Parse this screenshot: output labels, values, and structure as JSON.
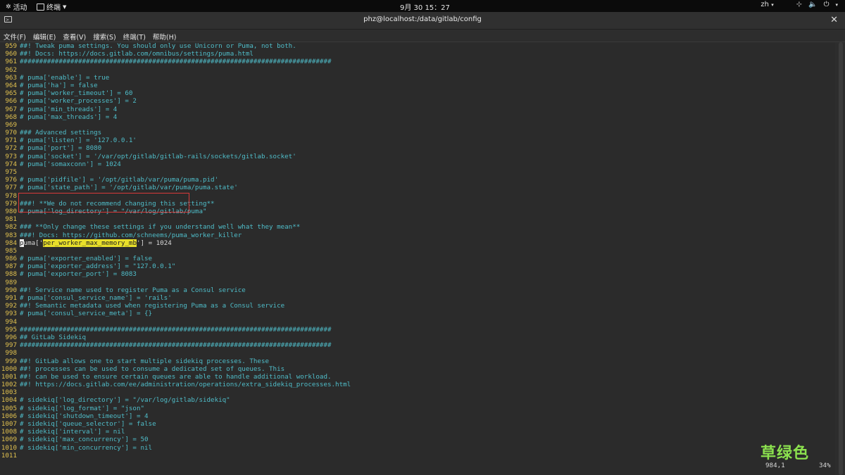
{
  "topbar": {
    "activities_label": "活动",
    "terminal_label": "终端",
    "clock": "9月 30 15：27",
    "lang": "zh"
  },
  "window": {
    "title": "phz@localhost:/data/gitlab/config"
  },
  "menu": [
    "文件(F)",
    "编辑(E)",
    "查看(V)",
    "搜索(S)",
    "终端(T)",
    "帮助(H)"
  ],
  "lines": [
    {
      "n": "959",
      "t": "##! Tweak puma settings. You should only use Unicorn or Puma, not both."
    },
    {
      "n": "960",
      "t": "##! Docs: https://docs.gitlab.com/omnibus/settings/puma.html"
    },
    {
      "n": "961",
      "t": "################################################################################"
    },
    {
      "n": "962",
      "t": ""
    },
    {
      "n": "963",
      "t": "# puma['enable'] = true"
    },
    {
      "n": "964",
      "t": "# puma['ha'] = false"
    },
    {
      "n": "965",
      "t": "# puma['worker_timeout'] = 60"
    },
    {
      "n": "966",
      "t": "# puma['worker_processes'] = 2"
    },
    {
      "n": "967",
      "t": "# puma['min_threads'] = 4"
    },
    {
      "n": "968",
      "t": "# puma['max_threads'] = 4"
    },
    {
      "n": "969",
      "t": ""
    },
    {
      "n": "970",
      "t": "### Advanced settings"
    },
    {
      "n": "971",
      "t": "# puma['listen'] = '127.0.0.1'"
    },
    {
      "n": "972",
      "t": "# puma['port'] = 8080"
    },
    {
      "n": "973",
      "t": "# puma['socket'] = '/var/opt/gitlab/gitlab-rails/sockets/gitlab.socket'"
    },
    {
      "n": "974",
      "t": "# puma['somaxconn'] = 1024"
    },
    {
      "n": "975",
      "t": ""
    },
    {
      "n": "976",
      "t": "# puma['pidfile'] = '/opt/gitlab/var/puma/puma.pid'"
    },
    {
      "n": "977",
      "t": "# puma['state_path'] = '/opt/gitlab/var/puma/puma.state'"
    },
    {
      "n": "978",
      "t": ""
    },
    {
      "n": "979",
      "t": "###! **We do not recommend changing this setting**"
    },
    {
      "n": "980",
      "t": "# puma['log_directory'] = \"/var/log/gitlab/puma\""
    },
    {
      "n": "981",
      "t": ""
    },
    {
      "n": "982",
      "t": "### **Only change these settings if you understand well what they mean**"
    },
    {
      "n": "983",
      "t": "###! Docs: https://github.com/schneems/puma_worker_killer"
    },
    {
      "n": "984",
      "special": true,
      "cursor_char": "p",
      "pre": "uma['",
      "hl": "per_worker_max_memory_mb",
      "post": "'] = 1024"
    },
    {
      "n": "985",
      "t": ""
    },
    {
      "n": "986",
      "t": "# puma['exporter_enabled'] = false"
    },
    {
      "n": "987",
      "t": "# puma['exporter_address'] = \"127.0.0.1\""
    },
    {
      "n": "988",
      "t": "# puma['exporter_port'] = 8083"
    },
    {
      "n": "989",
      "t": ""
    },
    {
      "n": "990",
      "t": "##! Service name used to register Puma as a Consul service"
    },
    {
      "n": "991",
      "t": "# puma['consul_service_name'] = 'rails'"
    },
    {
      "n": "992",
      "t": "##! Semantic metadata used when registering Puma as a Consul service"
    },
    {
      "n": "993",
      "t": "# puma['consul_service_meta'] = {}"
    },
    {
      "n": "994",
      "t": ""
    },
    {
      "n": "995",
      "t": "################################################################################"
    },
    {
      "n": "996",
      "t": "## GitLab Sidekiq"
    },
    {
      "n": "997",
      "t": "################################################################################"
    },
    {
      "n": "998",
      "t": ""
    },
    {
      "n": "999",
      "t": "##! GitLab allows one to start multiple sidekiq processes. These"
    },
    {
      "n": "1000",
      "t": "##! processes can be used to consume a dedicated set of queues. This"
    },
    {
      "n": "1001",
      "t": "##! can be used to ensure certain queues are able to handle additional workload."
    },
    {
      "n": "1002",
      "t": "##! https://docs.gitlab.com/ee/administration/operations/extra_sidekiq_processes.html"
    },
    {
      "n": "1003",
      "t": ""
    },
    {
      "n": "1004",
      "t": "# sidekiq['log_directory'] = \"/var/log/gitlab/sidekiq\""
    },
    {
      "n": "1005",
      "t": "# sidekiq['log_format'] = \"json\""
    },
    {
      "n": "1006",
      "t": "# sidekiq['shutdown_timeout'] = 4"
    },
    {
      "n": "1007",
      "t": "# sidekiq['queue_selector'] = false"
    },
    {
      "n": "1008",
      "t": "# sidekiq['interval'] = nil"
    },
    {
      "n": "1009",
      "t": "# sidekiq['max_concurrency'] = 50"
    },
    {
      "n": "1010",
      "t": "# sidekiq['min_concurrency'] = nil"
    },
    {
      "n": "1011",
      "t": ""
    }
  ],
  "status": {
    "position": "984,1",
    "percent": "34%"
  },
  "watermark": "草绿色"
}
